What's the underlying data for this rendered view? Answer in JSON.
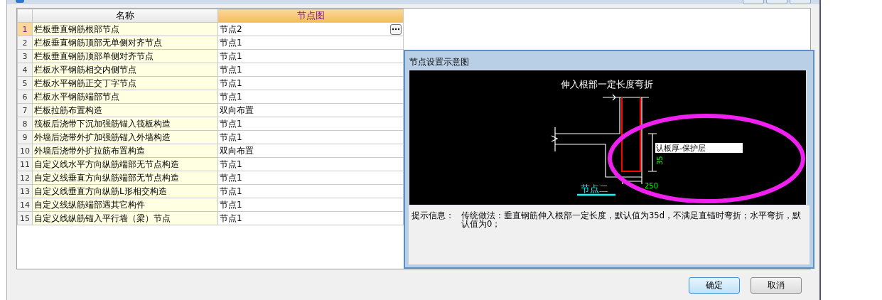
{
  "table": {
    "columns": [
      "名称",
      "节点图"
    ],
    "rows": [
      {
        "index": "1",
        "name": "栏板垂直钢筋根部节点",
        "value": "节点2",
        "selected": true
      },
      {
        "index": "2",
        "name": "栏板垂直钢筋顶部无单侧对齐节点",
        "value": "节点1",
        "selected": false
      },
      {
        "index": "3",
        "name": "栏板垂直钢筋顶部单侧对齐节点",
        "value": "节点1",
        "selected": false
      },
      {
        "index": "4",
        "name": "栏板水平钢筋相交内侧节点",
        "value": "节点1",
        "selected": false
      },
      {
        "index": "5",
        "name": "栏板水平钢筋正交丁字节点",
        "value": "节点1",
        "selected": false
      },
      {
        "index": "6",
        "name": "栏板水平钢筋端部节点",
        "value": "节点1",
        "selected": false
      },
      {
        "index": "7",
        "name": "栏板拉筋布置构造",
        "value": "双向布置",
        "selected": false
      },
      {
        "index": "8",
        "name": "筏板后浇带下沉加强筋锚入筏板构造",
        "value": "节点1",
        "selected": false
      },
      {
        "index": "9",
        "name": "外墙后浇带外扩加强筋锚入外墙构造",
        "value": "节点1",
        "selected": false
      },
      {
        "index": "10",
        "name": "外墙后浇带外扩拉筋布置构造",
        "value": "双向布置",
        "selected": false
      },
      {
        "index": "11",
        "name": "自定义线水平方向纵筋端部无节点构造",
        "value": "节点1",
        "selected": false
      },
      {
        "index": "12",
        "name": "自定义线垂直方向纵筋端部无节点构造",
        "value": "节点1",
        "selected": false
      },
      {
        "index": "13",
        "name": "自定义线垂直方向纵筋L形相交构造",
        "value": "节点1",
        "selected": false
      },
      {
        "index": "14",
        "name": "自定义线纵筋端部遇其它构件",
        "value": "节点1",
        "selected": false
      },
      {
        "index": "15",
        "name": "自定义线纵筋锚入平行墙（梁）节点",
        "value": "节点1",
        "selected": false
      }
    ]
  },
  "preview": {
    "title": "节点设置示意图",
    "diagram": {
      "title": "伸入根部一定长度弯折",
      "callout": "认板厚-保护层",
      "dim_vertical": "35",
      "dim_horizontal": "250",
      "node_label": "节点二"
    },
    "hint_label": "提示信息：",
    "hint_text": "传统做法：垂直钢筋伸入根部一定长度，默认值为35d，不满足直锚时弯折；水平弯折，默认值为0；"
  },
  "buttons": [
    {
      "label": "确定",
      "default": true
    },
    {
      "label": "取消",
      "default": false
    }
  ]
}
